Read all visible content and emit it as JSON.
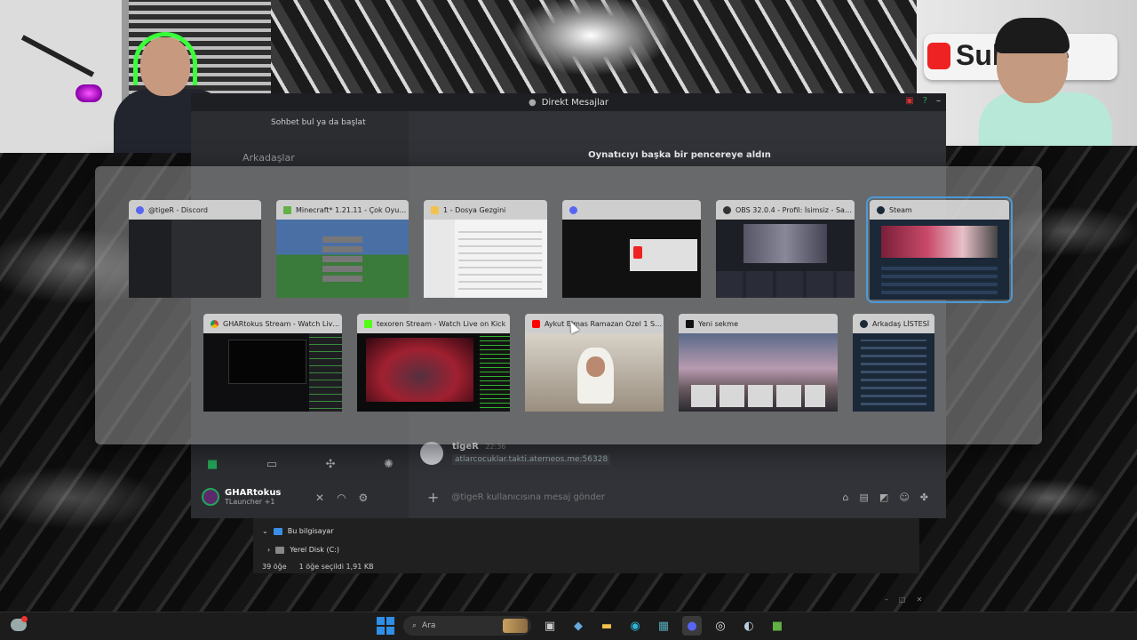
{
  "webcam_right": {
    "banner_text": "Sub  ribe"
  },
  "discord": {
    "title": "Direkt Mesajlar",
    "search_placeholder": "Sohbet bul ya da başlat",
    "friends_label": "Arkadaşlar",
    "popout_notice": "Oynatıcıyı başka bir pencereye aldın",
    "message": {
      "author": "tigeR",
      "time": "22:36",
      "text": "atlarcocuklar.takti.aterneos.me:56328"
    },
    "composer_placeholder": "@tigeR kullanıcısına mesaj gönder",
    "user": {
      "name": "GHARtokus",
      "status": "TLauncher +1"
    }
  },
  "explorer": {
    "tree_items": [
      "Bu bilgisayar",
      "Yerel Disk (C:)"
    ],
    "item_count": "39 öğe",
    "selection": "1 öğe seçildi  1,91 KB"
  },
  "switcher": {
    "row1": [
      {
        "title": "@tigeR - Discord",
        "icon_color": "#5865f2"
      },
      {
        "title": "Minecraft* 1.21.11 - Çok Oyuncu...",
        "icon_color": "#62b145"
      },
      {
        "title": "1 - Dosya Gezgini",
        "icon_color": "#f2c14e"
      },
      {
        "title": "",
        "icon_color": "#5865f2"
      },
      {
        "title": "OBS 32.0.4 - Profil: İsimsiz - Sahn...",
        "icon_color": "#333333"
      },
      {
        "title": "Steam",
        "icon_color": "#1b2838"
      }
    ],
    "row2": [
      {
        "title": "GHARtokus Stream - Watch Live...",
        "icon_color": "#4285f4"
      },
      {
        "title": "texoren Stream - Watch Live on Kick",
        "icon_color": "#53fc18"
      },
      {
        "title": "Aykut Elmas Ramazan Özel 1 Saa...",
        "icon_color": "#ff0000"
      },
      {
        "title": "Yeni sekme",
        "icon_color": "#111111"
      },
      {
        "title": "Arkadaş LİSTESİ",
        "icon_color": "#1b2838"
      }
    ]
  },
  "taskbar": {
    "search_placeholder": "Ara"
  }
}
